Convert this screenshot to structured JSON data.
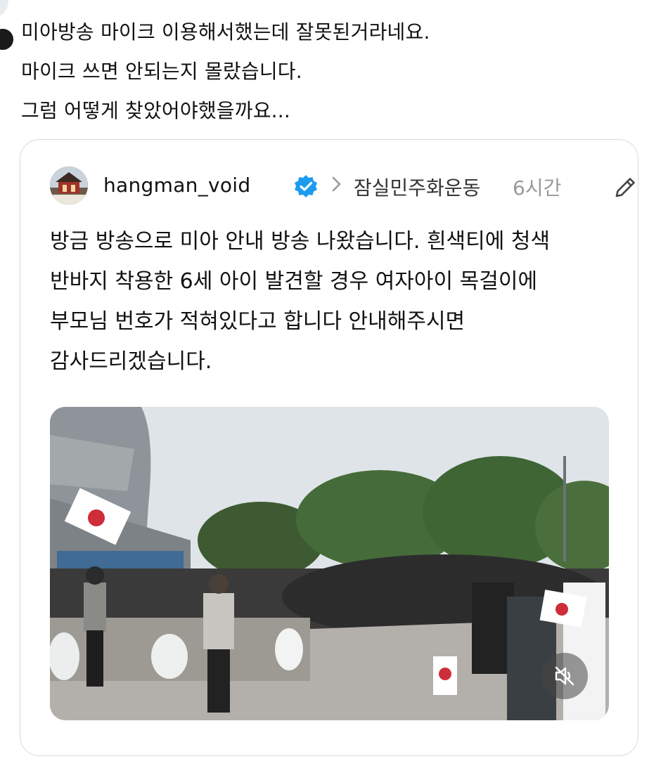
{
  "reply": {
    "lines": [
      "미아방송 마이크 이용해서했는데 잘못된거라네요.",
      "마이크 쓰면 안되는지 몰랐습니다.",
      "그럼 어떻게 찾았어야했을까요..."
    ]
  },
  "quoted_post": {
    "username": "hangman_void",
    "topic": "잠실민주화운동",
    "time": "6시간",
    "body_lines": [
      "방금 방송으로 미아 안내 방송 나왔습니다. 흰색티에 청색",
      "반바지 착용한 6세 아이 발견할 경우 여자아이 목걸이에",
      "부모님 번호가 적혀있다고 합니다 안내해주시면",
      "감사드리겠습니다."
    ],
    "icons": {
      "verified": "verified-badge-icon",
      "chevron": "chevron-right-icon",
      "edit": "pencil-icon",
      "mute": "speaker-muted-icon"
    }
  },
  "colors": {
    "verified_blue": "#1d9bf0",
    "muted_text": "#9a9a9a",
    "card_border": "#d9d9d9"
  }
}
